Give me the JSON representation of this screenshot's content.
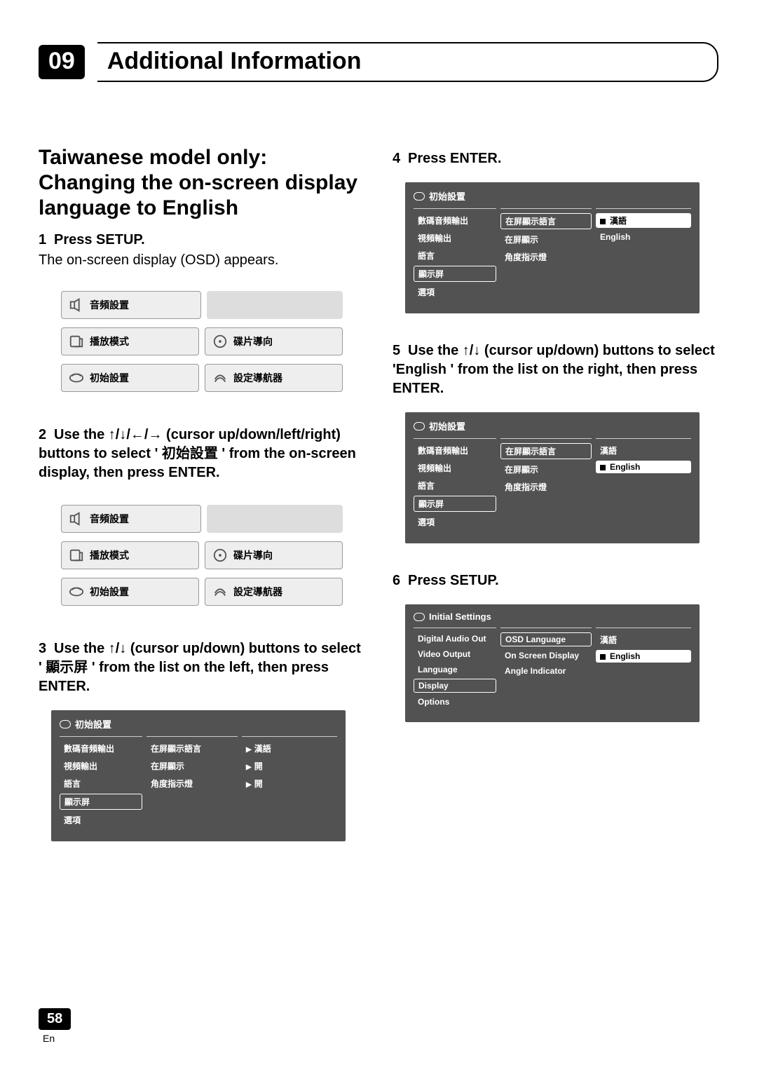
{
  "chapter": {
    "number": "09",
    "title": "Additional Information"
  },
  "heading": "Taiwanese model only: Changing the on-screen display language to English",
  "steps": {
    "s1": {
      "label": "Press SETUP.",
      "desc": "The on-screen display (OSD) appears."
    },
    "s2": {
      "label": "Use the ↑/↓/←/→ (cursor up/down/left/right) buttons to select ' 初始設置 ' from the on-screen display, then press ENTER."
    },
    "s3": {
      "label": "Use the ↑/↓ (cursor up/down) buttons to select ' 顯示屏 ' from the list on the left, then press ENTER."
    },
    "s4": {
      "label": "Press ENTER."
    },
    "s5": {
      "label": "Use the ↑/↓ (cursor up/down) buttons to select 'English ' from the list on the right, then press ENTER."
    },
    "s6": {
      "label": "Press SETUP."
    }
  },
  "osd_grid": {
    "audio": "音頻設置",
    "play": "播放模式",
    "disc": "碟片導向",
    "init": "初始設置",
    "nav": "設定導航器"
  },
  "panel_cn": {
    "title": "初始設置",
    "col1": [
      "數碼音頻輸出",
      "視頻輸出",
      "語言",
      "顯示屏",
      "選項"
    ],
    "col2": [
      "在屏顯示語言",
      "在屏顯示",
      "角度指示燈"
    ],
    "step3_col3": [
      "漢語",
      "開",
      "開"
    ],
    "step4_col3": [
      "漢語",
      "English"
    ],
    "step5_col3": [
      "漢語",
      "English"
    ]
  },
  "panel_en": {
    "title": "Initial Settings",
    "col1": [
      "Digital Audio Out",
      "Video Output",
      "Language",
      "Display",
      "Options"
    ],
    "col2": [
      "OSD Language",
      "On Screen Display",
      "Angle Indicator"
    ],
    "col3": [
      "漢語",
      "English"
    ]
  },
  "footer": {
    "page": "58",
    "lang": "En"
  }
}
